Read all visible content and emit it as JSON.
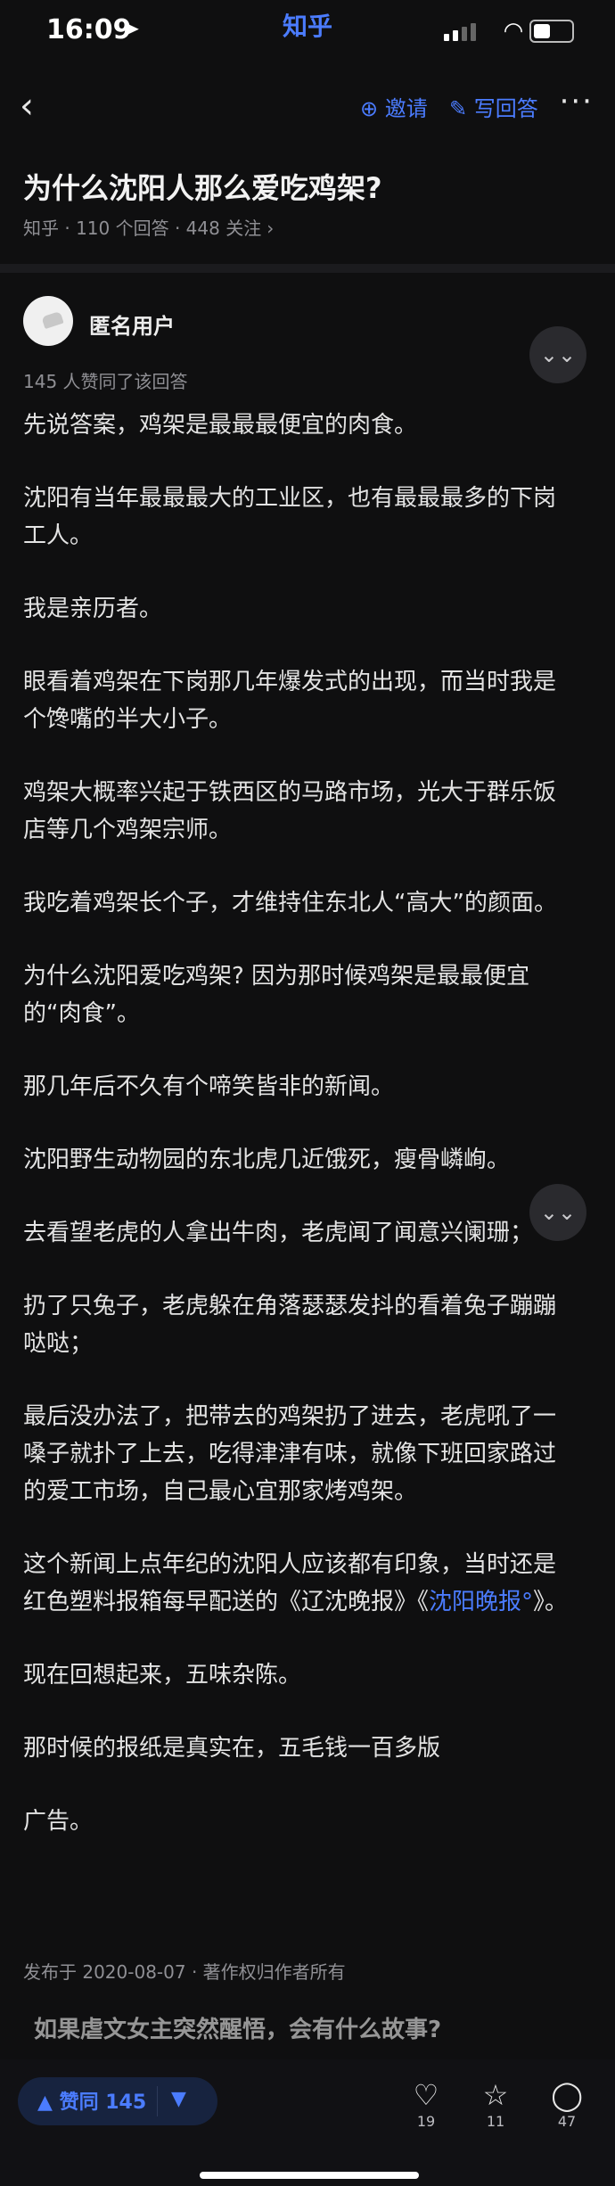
{
  "status": {
    "time": "16:09",
    "app": "知乎"
  },
  "topbar": {
    "back_icon": "‹",
    "invite": "邀请",
    "write": "写回答",
    "more": "···"
  },
  "question": {
    "title": "为什么沈阳人那么爱吃鸡架?",
    "meta": "知乎 · 110 个回答 · 448 关注"
  },
  "answer": {
    "author": "匿名用户",
    "likes_note": "145 人赞同了该回答",
    "paragraphs": [
      "先说答案，鸡架是最最最便宜的肉食。",
      "沈阳有当年最最最大的工业区，也有最最最多的下岗工人。",
      "我是亲历者。",
      "眼看着鸡架在下岗那几年爆发式的出现，而当时我是个馋嘴的半大小子。",
      "鸡架大概率兴起于铁西区的马路市场，光大于群乐饭店等几个鸡架宗师。",
      "我吃着鸡架长个子，才维持住东北人“高大”的颜面。",
      "为什么沈阳爱吃鸡架? 因为那时候鸡架是最最便宜的“肉食”。",
      "那几年后不久有个啼笑皆非的新闻。",
      "沈阳野生动物园的东北虎几近饿死，瘦骨嶙峋。",
      "去看望老虎的人拿出牛肉，老虎闻了闻意兴阑珊；",
      "扔了只兔子，老虎躲在角落瑟瑟发抖的看着兔子蹦蹦哒哒；",
      "最后没办法了，把带去的鸡架扔了进去，老虎吼了一嗓子就扑了上去，吃得津津有味，就像下班回家路过的爱工市场，自己最心宜那家烤鸡架。",
      "现在回想起来，五味杂陈。",
      "那时候的报纸是真实在，五毛钱一百多版",
      "广告。"
    ],
    "p13_prefix": "这个新闻上点年纪的沈阳人应该都有印象，当时还是红色塑料报箱每早配送的《辽沈晚报》《",
    "p13_link": "沈阳晚报",
    "p13_suffix": "》。",
    "footer": "发布于 2020-08-07 · 著作权归作者所有"
  },
  "next_question": "如果虐文女主突然醒悟，会有什么故事?",
  "bottom": {
    "upvote": "赞同 145",
    "likes": "19",
    "favorites": "11",
    "comments": "47"
  }
}
